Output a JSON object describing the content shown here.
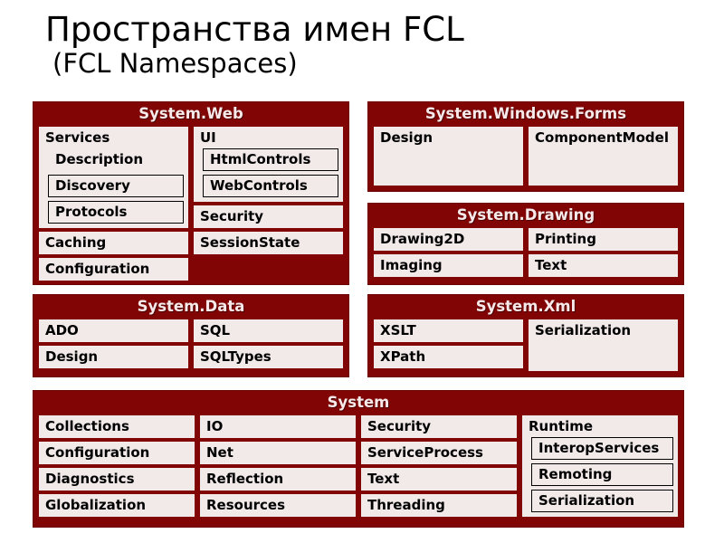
{
  "slide": {
    "title_ru": "Пространства имен FCL",
    "title_en": "(FCL Namespaces)",
    "colors": {
      "block_background": "#820505",
      "block_title_text": "#F7E9E9",
      "namespace_box": "#F2E9E9",
      "namespace_text": "#000000",
      "page_background": "#FFFFFF"
    }
  },
  "blocks": [
    {
      "id": "system-web",
      "title": "System.Web",
      "columns": [
        {
          "items": [
            {
              "label": "Services",
              "type": "group",
              "children": [
                {
                  "label": "Description",
                  "bordered": false
                },
                {
                  "label": "Discovery",
                  "bordered": true
                },
                {
                  "label": "Protocols",
                  "bordered": true
                }
              ]
            },
            {
              "label": "Caching",
              "type": "leaf"
            },
            {
              "label": "Configuration",
              "type": "leaf"
            }
          ]
        },
        {
          "items": [
            {
              "label": "UI",
              "type": "group",
              "children": [
                {
                  "label": "HtmlControls",
                  "bordered": true
                },
                {
                  "label": "WebControls",
                  "bordered": true
                }
              ]
            },
            {
              "label": "Security",
              "type": "leaf"
            },
            {
              "label": "SessionState",
              "type": "leaf"
            }
          ]
        }
      ]
    },
    {
      "id": "system-windows-forms",
      "title": "System.Windows.Forms",
      "columns": [
        {
          "items": [
            {
              "label": "Design",
              "type": "leaf-tall"
            }
          ]
        },
        {
          "items": [
            {
              "label": "ComponentModel",
              "type": "leaf-tall"
            }
          ]
        }
      ]
    },
    {
      "id": "system-drawing",
      "title": "System.Drawing",
      "columns": [
        {
          "items": [
            {
              "label": "Drawing2D",
              "type": "leaf"
            },
            {
              "label": "Imaging",
              "type": "leaf"
            }
          ]
        },
        {
          "items": [
            {
              "label": "Printing",
              "type": "leaf"
            },
            {
              "label": "Text",
              "type": "leaf"
            }
          ]
        }
      ]
    },
    {
      "id": "system-data",
      "title": "System.Data",
      "columns": [
        {
          "items": [
            {
              "label": "ADO",
              "type": "leaf"
            },
            {
              "label": "Design",
              "type": "leaf"
            }
          ]
        },
        {
          "items": [
            {
              "label": "SQL",
              "type": "leaf"
            },
            {
              "label": "SQLTypes",
              "type": "leaf"
            }
          ]
        }
      ]
    },
    {
      "id": "system-xml",
      "title": "System.Xml",
      "columns": [
        {
          "items": [
            {
              "label": "XSLT",
              "type": "leaf"
            },
            {
              "label": "XPath",
              "type": "leaf"
            }
          ]
        },
        {
          "items": [
            {
              "label": "Serialization",
              "type": "leaf-tall"
            }
          ]
        }
      ]
    },
    {
      "id": "system",
      "title": "System",
      "columns": [
        {
          "items": [
            {
              "label": "Collections",
              "type": "leaf"
            },
            {
              "label": "Configuration",
              "type": "leaf"
            },
            {
              "label": "Diagnostics",
              "type": "leaf"
            },
            {
              "label": "Globalization",
              "type": "leaf"
            }
          ]
        },
        {
          "items": [
            {
              "label": "IO",
              "type": "leaf"
            },
            {
              "label": "Net",
              "type": "leaf"
            },
            {
              "label": "Reflection",
              "type": "leaf"
            },
            {
              "label": "Resources",
              "type": "leaf"
            }
          ]
        },
        {
          "items": [
            {
              "label": "Security",
              "type": "leaf"
            },
            {
              "label": "ServiceProcess",
              "type": "leaf"
            },
            {
              "label": "Text",
              "type": "leaf"
            },
            {
              "label": "Threading",
              "type": "leaf"
            }
          ]
        },
        {
          "items": [
            {
              "label": "Runtime",
              "type": "group",
              "children": [
                {
                  "label": "InteropServices",
                  "bordered": true
                },
                {
                  "label": "Remoting",
                  "bordered": true
                },
                {
                  "label": "Serialization",
                  "bordered": true
                }
              ]
            }
          ]
        }
      ]
    }
  ]
}
